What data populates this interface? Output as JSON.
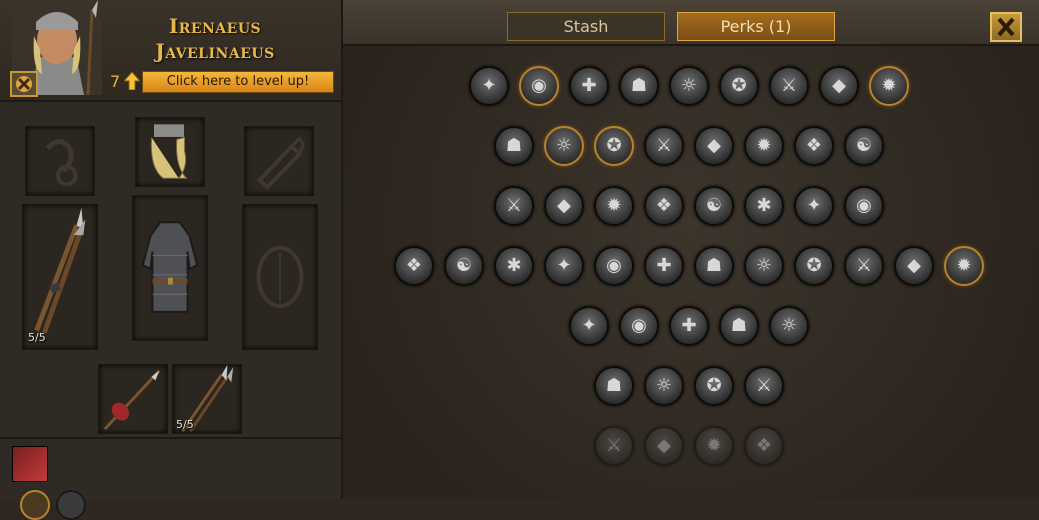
{
  "character": {
    "name_line1": "Irenaeus",
    "name_line2": "Javelinaeus",
    "level": "7",
    "level_up_label": "Click here to level up!"
  },
  "equipment": {
    "ammo_count": "5/5",
    "bag_count": "5/5",
    "slots": [
      "accessory",
      "helmet",
      "ammo-quiver",
      "main-hand-javelins",
      "body-armor",
      "offhand-shield",
      "bag-spear",
      "bag-javelins"
    ]
  },
  "tabs": {
    "stash_label": "Stash",
    "perks_label": "Perks (1)"
  },
  "perks": {
    "rows": [
      [
        {
          "icon": "rally-icon",
          "state": "normal"
        },
        {
          "icon": "colossus-icon",
          "state": "owned"
        },
        {
          "icon": "nine-lives-icon",
          "state": "normal"
        },
        {
          "icon": "bags-icon",
          "state": "normal"
        },
        {
          "icon": "recover-icon",
          "state": "normal"
        },
        {
          "icon": "pathfinder-icon",
          "state": "normal"
        },
        {
          "icon": "adrenaline-icon",
          "state": "normal"
        },
        {
          "icon": "lungs-icon",
          "state": "normal"
        },
        {
          "icon": "student-icon",
          "state": "owned"
        }
      ],
      [
        {
          "icon": "axe-throw-icon",
          "state": "normal"
        },
        {
          "icon": "bullseye-icon",
          "state": "owned"
        },
        {
          "icon": "dodge-icon",
          "state": "owned"
        },
        {
          "icon": "fortified-mind-icon",
          "state": "normal"
        },
        {
          "icon": "hold-out-icon",
          "state": "normal"
        },
        {
          "icon": "steel-brow-icon",
          "state": "normal"
        },
        {
          "icon": "quick-hands-icon",
          "state": "normal"
        },
        {
          "icon": "gifted-icon",
          "state": "normal"
        }
      ],
      [
        {
          "icon": "backstabber-icon",
          "state": "normal"
        },
        {
          "icon": "anticipation-icon",
          "state": "normal"
        },
        {
          "icon": "shield-expert-icon",
          "state": "normal"
        },
        {
          "icon": "brawny-icon",
          "state": "normal"
        },
        {
          "icon": "rotation-icon",
          "state": "normal"
        },
        {
          "icon": "rally-the-troops-icon",
          "state": "normal"
        },
        {
          "icon": "taunt-icon",
          "state": "normal"
        },
        {
          "icon": "fist-icon",
          "state": "normal"
        }
      ],
      [
        {
          "icon": "mace-mastery-icon",
          "state": "normal"
        },
        {
          "icon": "flail-mastery-icon",
          "state": "normal"
        },
        {
          "icon": "hammer-mastery-icon",
          "state": "normal"
        },
        {
          "icon": "axe-mastery-icon",
          "state": "normal"
        },
        {
          "icon": "cleaver-mastery-icon",
          "state": "normal"
        },
        {
          "icon": "sword-mastery-icon",
          "state": "normal"
        },
        {
          "icon": "dagger-mastery-icon",
          "state": "normal"
        },
        {
          "icon": "polearm-mastery-icon",
          "state": "normal"
        },
        {
          "icon": "spear-mastery-icon",
          "state": "normal"
        },
        {
          "icon": "crossbow-mastery-icon",
          "state": "normal"
        },
        {
          "icon": "bow-mastery-icon",
          "state": "normal"
        },
        {
          "icon": "throwing-mastery-icon",
          "state": "owned"
        }
      ],
      [
        {
          "icon": "underdog-icon",
          "state": "normal"
        },
        {
          "icon": "reach-advantage-icon",
          "state": "normal"
        },
        {
          "icon": "overwhelm-icon",
          "state": "normal"
        },
        {
          "icon": "lone-wolf-icon",
          "state": "normal"
        },
        {
          "icon": "footwork-icon",
          "state": "normal"
        }
      ],
      [
        {
          "icon": "berserk-icon",
          "state": "normal"
        },
        {
          "icon": "head-hunter-icon",
          "state": "normal"
        },
        {
          "icon": "nimble-icon",
          "state": "normal"
        },
        {
          "icon": "battle-forged-icon",
          "state": "normal"
        }
      ],
      [
        {
          "icon": "fearsome-icon",
          "state": "locked"
        },
        {
          "icon": "duelist-icon",
          "state": "locked"
        },
        {
          "icon": "killing-frenzy-icon",
          "state": "locked"
        },
        {
          "icon": "indomitable-icon",
          "state": "locked"
        }
      ]
    ]
  },
  "colors": {
    "accent_gold": "#e8b74a",
    "level_button": "#f4b73a",
    "owned_ring": "#b8832c"
  }
}
